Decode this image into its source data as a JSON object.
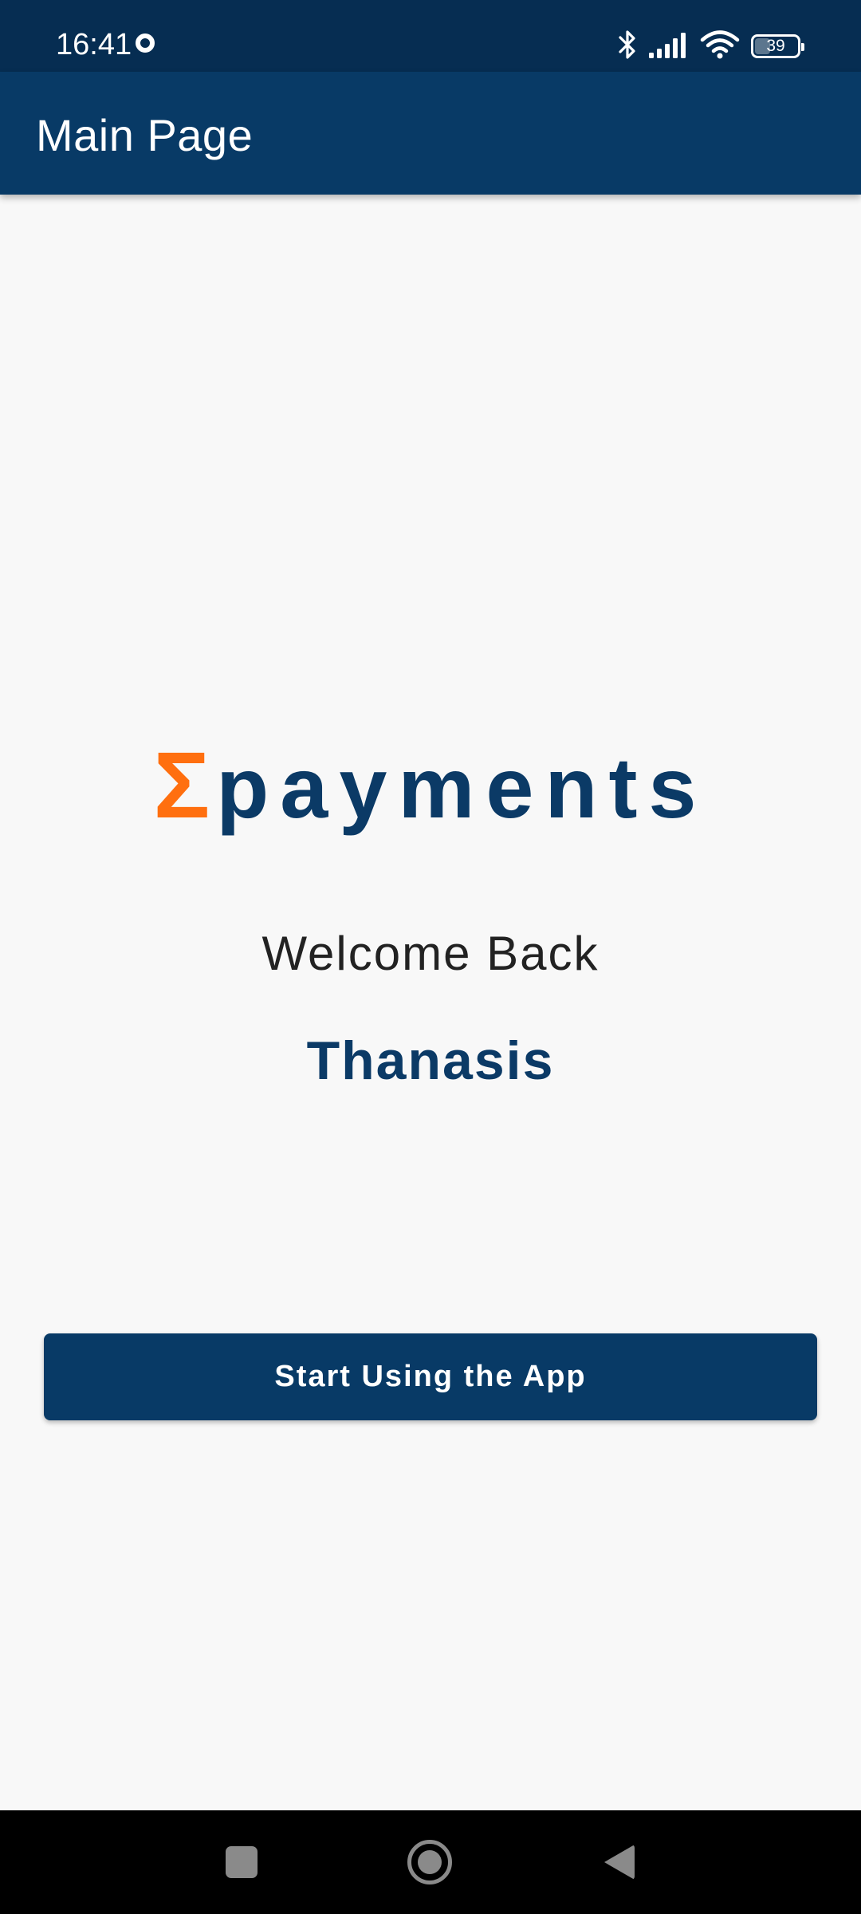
{
  "status_bar": {
    "time": "16:41",
    "battery_level": "39",
    "icons": [
      "record-indicator-icon",
      "bluetooth-icon",
      "signal-icon",
      "wifi-icon",
      "battery-icon"
    ]
  },
  "app_bar": {
    "title": "Main Page"
  },
  "brand": {
    "symbol": "Σ",
    "word": "payments"
  },
  "welcome": {
    "greeting": "Welcome Back",
    "user_name": "Thanasis"
  },
  "actions": {
    "start_label": "Start Using the App"
  },
  "nav_bar": {
    "icons": [
      "recents-icon",
      "home-icon",
      "back-icon"
    ]
  },
  "colors": {
    "status_bar": "#062d52",
    "primary": "#083a66",
    "accent": "#ff6f0f",
    "background": "#f8f8f8",
    "text_dark": "#222222"
  }
}
